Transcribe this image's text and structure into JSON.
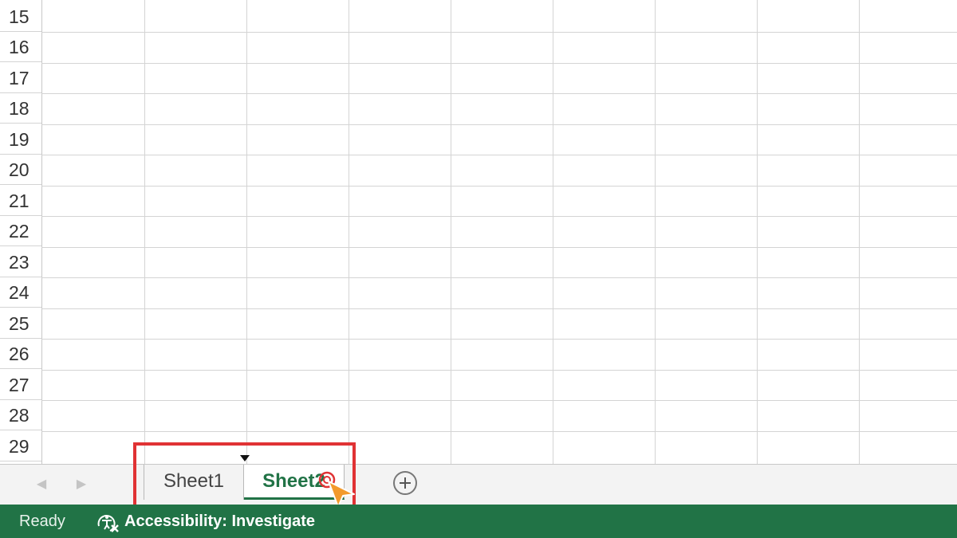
{
  "grid": {
    "row_numbers": [
      "15",
      "16",
      "17",
      "18",
      "19",
      "20",
      "21",
      "22",
      "23",
      "24",
      "25",
      "26",
      "27",
      "28",
      "29"
    ]
  },
  "tabs": {
    "nav_prev_icon": "chevron-left",
    "nav_next_icon": "chevron-right",
    "sheets": [
      {
        "label": "Sheet1",
        "active": false
      },
      {
        "label": "Sheet2",
        "active": true
      }
    ],
    "add_icon": "plus-circle"
  },
  "status": {
    "ready": "Ready",
    "accessibility": "Accessibility: Investigate"
  },
  "colors": {
    "excel_green": "#217346",
    "highlight_red": "#e03234",
    "cursor_orange": "#f39a2c"
  }
}
